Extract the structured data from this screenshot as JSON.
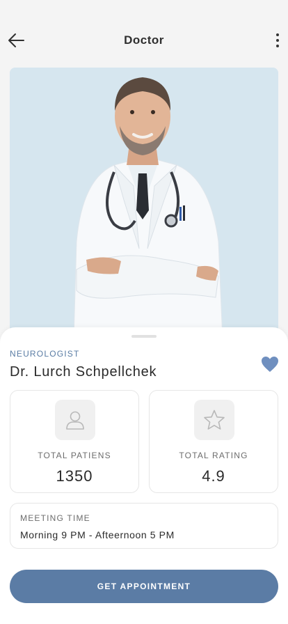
{
  "header": {
    "title": "Doctor",
    "back_icon": "arrow-left-icon",
    "menu_icon": "more-vertical-icon"
  },
  "doctor": {
    "specialty": "NEUROLOGIST",
    "name": "Dr. Lurch Schpellchek",
    "favorite_icon": "heart-icon",
    "is_favorite": true
  },
  "stats": [
    {
      "icon": "user-icon",
      "label": "TOTAL PATIENS",
      "value": "1350"
    },
    {
      "icon": "star-icon",
      "label": "TOTAL RATING",
      "value": "4.9"
    }
  ],
  "meeting": {
    "label": "MEETING TIME",
    "value": "Morning 9 PM - Afteernoon 5 PM"
  },
  "cta": {
    "label": "GET APPOINTMENT"
  },
  "colors": {
    "accent": "#5b7ca5",
    "heart": "#6f8fbf",
    "photo_background": "#d6e6ef",
    "page_background": "#f4f4f4"
  }
}
